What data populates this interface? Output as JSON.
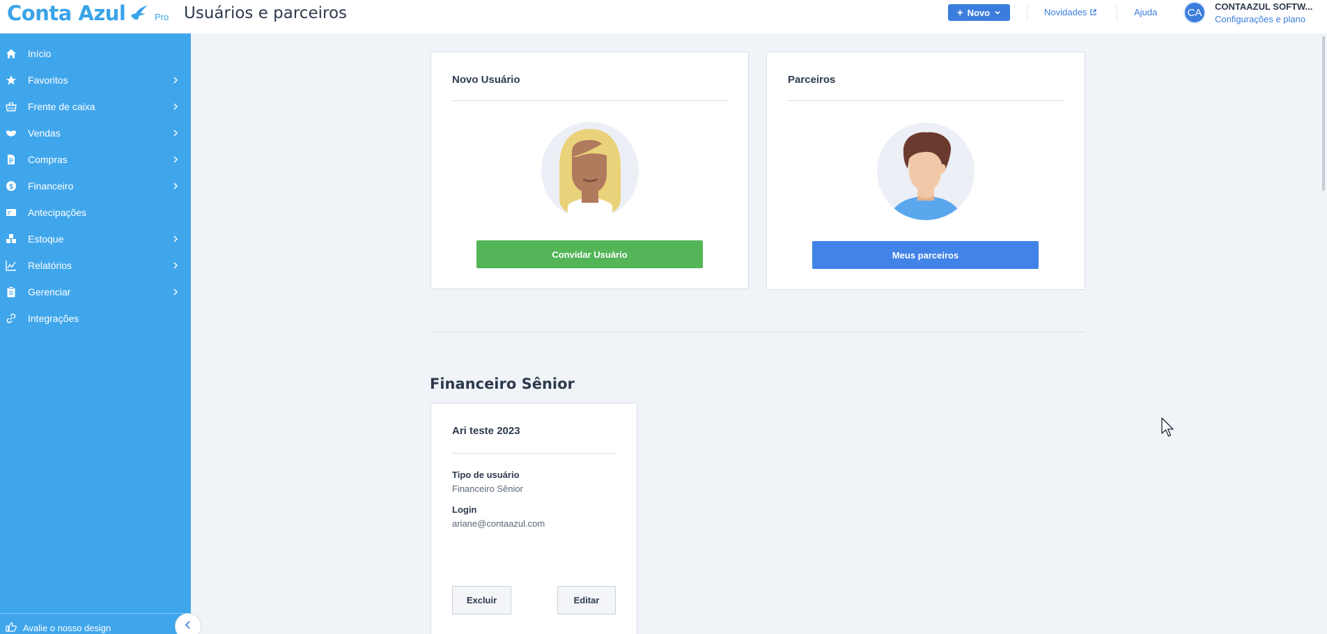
{
  "header": {
    "logo_text": "Conta Azul",
    "logo_badge": "Pro",
    "page_title": "Usuários e parceiros",
    "new_button_label": "Novo",
    "novidades_label": "Novidades",
    "ajuda_label": "Ajuda",
    "avatar_initials": "CA",
    "company_name": "CONTAAZUL SOFTW...",
    "company_subtitle": "Configurações e plano"
  },
  "sidebar": {
    "items": [
      {
        "label": "Início",
        "icon": "home-icon",
        "has_submenu": false
      },
      {
        "label": "Favoritos",
        "icon": "star-icon",
        "has_submenu": true
      },
      {
        "label": "Frente de caixa",
        "icon": "basket-icon",
        "has_submenu": true
      },
      {
        "label": "Vendas",
        "icon": "handshake-icon",
        "has_submenu": true
      },
      {
        "label": "Compras",
        "icon": "document-icon",
        "has_submenu": true
      },
      {
        "label": "Financeiro",
        "icon": "dollar-icon",
        "has_submenu": true
      },
      {
        "label": "Antecipações",
        "icon": "card-icon",
        "has_submenu": false
      },
      {
        "label": "Estoque",
        "icon": "boxes-icon",
        "has_submenu": true
      },
      {
        "label": "Relatórios",
        "icon": "chart-icon",
        "has_submenu": true
      },
      {
        "label": "Gerenciar",
        "icon": "clipboard-icon",
        "has_submenu": true
      },
      {
        "label": "Integrações",
        "icon": "link-icon",
        "has_submenu": false
      }
    ],
    "feedback_label": "Avalie o nosso design"
  },
  "main": {
    "new_user_card": {
      "title": "Novo Usuário",
      "button_label": "Convidar Usuário"
    },
    "partners_card": {
      "title": "Parceiros",
      "button_label": "Meus parceiros"
    },
    "section_title": "Financeiro Sênior",
    "user_card": {
      "name": "Ari teste 2023",
      "type_label": "Tipo de usuário",
      "type_value": "Financeiro Sênior",
      "login_label": "Login",
      "login_value": "ariane@contaazul.com",
      "delete_label": "Excluir",
      "edit_label": "Editar"
    }
  },
  "colors": {
    "sidebar_bg": "#40a6ec",
    "primary": "#3b7ddd",
    "green_button": "#53b557",
    "blue_button": "#4183e6",
    "page_bg": "#f0f3f7"
  }
}
